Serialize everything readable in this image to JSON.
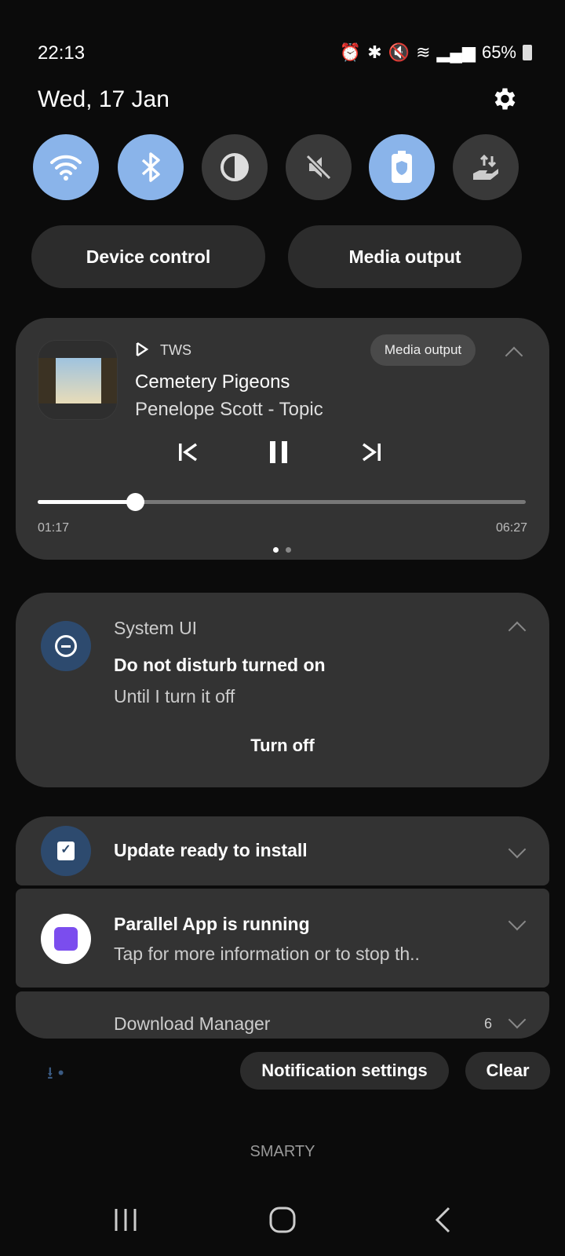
{
  "status_bar": {
    "time": "22:13",
    "battery": "65%",
    "icons": [
      "alarm-icon",
      "bluetooth-icon",
      "mute-icon",
      "wifi-icon",
      "signal-icon",
      "battery-charging-icon"
    ]
  },
  "header": {
    "date": "Wed, 17 Jan"
  },
  "quick_settings": [
    {
      "name": "wifi",
      "active": true
    },
    {
      "name": "bluetooth",
      "active": true
    },
    {
      "name": "dark-mode",
      "active": false
    },
    {
      "name": "mute",
      "active": false
    },
    {
      "name": "power-saving",
      "active": true
    },
    {
      "name": "data-transfer",
      "active": false
    }
  ],
  "buttons": {
    "device_control": "Device control",
    "media_output": "Media output"
  },
  "media": {
    "app": "TWS",
    "output_label": "Media output",
    "title": "Cemetery Pigeons",
    "artist": "Penelope Scott - Topic",
    "elapsed": "01:17",
    "total": "06:27",
    "progress": 0.199
  },
  "dnd": {
    "app": "System UI",
    "title": "Do not disturb turned on",
    "text": "Until I turn it off",
    "action": "Turn off"
  },
  "notifications": [
    {
      "title": "Update ready to install"
    },
    {
      "title": "Parallel App is running",
      "text": "Tap for more information or to stop th.."
    },
    {
      "title": "Download Manager",
      "count": "6"
    }
  ],
  "footer": {
    "settings": "Notification settings",
    "clear": "Clear",
    "carrier": "SMARTY"
  },
  "colors": {
    "accent": "#8ab4ea",
    "card": "#333333",
    "background": "#0b0b0b"
  }
}
